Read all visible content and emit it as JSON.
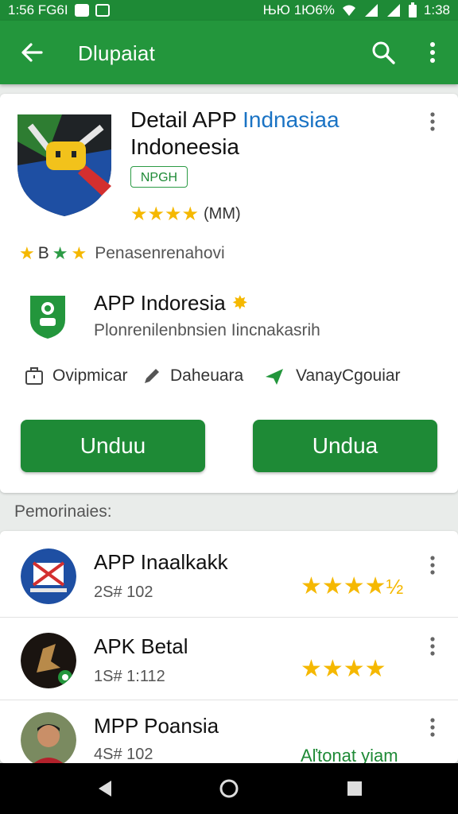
{
  "status_bar": {
    "left_text": "1:56 FG6I",
    "indicators": "ЊЮ 1Ю6%",
    "time": "1:38"
  },
  "app_bar": {
    "title": "Dlupaiat"
  },
  "detail": {
    "title_line1": "Detail APP",
    "title_accent": "Indnasiaa",
    "title_line2": "Indoneesia",
    "badge": "NPGH",
    "rating_label": "(MM)",
    "stats_text": "Penasenrenahovi",
    "stats_badge": "B",
    "developer_name": "APP Indoresia",
    "developer_subtitle": "Plonrenilenbnsien Iincnakasrih",
    "meta": [
      {
        "icon": "briefcase-icon",
        "label": "Ovipmicar"
      },
      {
        "icon": "pencil-icon",
        "label": "Daheuara"
      },
      {
        "icon": "send-icon",
        "label": "VanayCgouiar"
      }
    ],
    "buttons": {
      "left": "Unduu",
      "right": "Undua"
    }
  },
  "section_label": "Pemorinaies:",
  "list": [
    {
      "title": "APP Inaalkakk",
      "subtitle": "2S# 102",
      "right": "",
      "stars": 4.5
    },
    {
      "title": "APK Betal",
      "subtitle": "1S# 1:112",
      "right": "",
      "stars": 4
    },
    {
      "title": "MPP Poansia",
      "subtitle": "4S# 102",
      "right": "Aľtonat yiam",
      "stars": null
    }
  ],
  "colors": {
    "primary": "#23963c",
    "accent_blue": "#1a73c4",
    "star": "#f5b800"
  }
}
